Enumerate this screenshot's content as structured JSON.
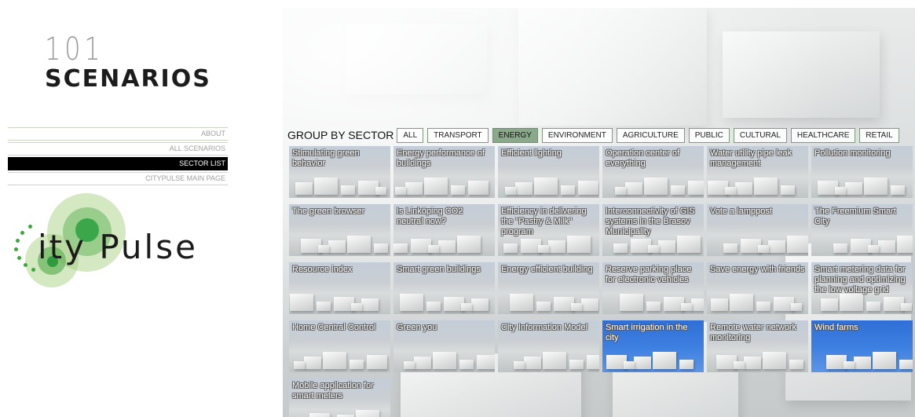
{
  "logo": {
    "number": "101",
    "word": "SCENARIOS"
  },
  "menu": [
    {
      "label": "ABOUT",
      "active": false
    },
    {
      "label": "ALL SCENARIOS",
      "active": false
    },
    {
      "label": "SECTOR LIST",
      "active": true
    },
    {
      "label": "CITYPULSE MAIN PAGE",
      "active": false
    }
  ],
  "citypulse_logo": {
    "text": "ity Pulse"
  },
  "sector_bar": {
    "label": "GROUP BY SECTOR",
    "buttons": [
      {
        "label": "ALL",
        "active": false
      },
      {
        "label": "TRANSPORT",
        "active": false
      },
      {
        "label": "ENERGY",
        "active": true
      },
      {
        "label": "ENVIRONMENT",
        "active": false
      },
      {
        "label": "AGRICULTURE",
        "active": false
      },
      {
        "label": "PUBLIC",
        "active": false
      },
      {
        "label": "CULTURAL",
        "active": false
      },
      {
        "label": "HEALTHCARE",
        "active": false
      },
      {
        "label": "RETAIL",
        "active": false
      }
    ]
  },
  "scenarios": [
    {
      "title": "Stimulating green behavior",
      "tint": "grey"
    },
    {
      "title": "Energy performance of buildings",
      "tint": "grey"
    },
    {
      "title": "Efficient lighting",
      "tint": "grey"
    },
    {
      "title": "Operation center of everything",
      "tint": "grey"
    },
    {
      "title": "Water utility pipe leak management",
      "tint": "grey"
    },
    {
      "title": "Pollution monitoring",
      "tint": "grey"
    },
    {
      "title": "The green browser",
      "tint": "grey"
    },
    {
      "title": "Is Linköping CO2 neutral now?",
      "tint": "grey"
    },
    {
      "title": "Efficiency in delivering the \"Pastry & Milk\" program",
      "tint": "grey"
    },
    {
      "title": "Interconnectivity of GIS systems in the Brasov Municipality",
      "tint": "grey"
    },
    {
      "title": "Vote a lamppost",
      "tint": "grey"
    },
    {
      "title": "The Freemium Smart City",
      "tint": "grey"
    },
    {
      "title": "Resource index",
      "tint": "grey"
    },
    {
      "title": "Smart green buildings",
      "tint": "grey"
    },
    {
      "title": "Energy efficient building",
      "tint": "grey"
    },
    {
      "title": "Reserve parking place for electronic vehicles",
      "tint": "grey"
    },
    {
      "title": "Save energy with friends",
      "tint": "grey"
    },
    {
      "title": "Smart metering data for planning and optimizing the low voltage grid",
      "tint": "grey"
    },
    {
      "title": "Home Central Control",
      "tint": "grey"
    },
    {
      "title": "Green you",
      "tint": "grey"
    },
    {
      "title": "City Information Model",
      "tint": "grey"
    },
    {
      "title": "Smart irrigation in the city",
      "tint": "blue"
    },
    {
      "title": "Remote water network monitoring",
      "tint": "grey"
    },
    {
      "title": "Wind farms",
      "tint": "blue"
    },
    {
      "title": "Mobile application for smart meters",
      "tint": "grey"
    }
  ],
  "colors": {
    "active_menu": "#000000",
    "active_sector": "#8aa88a",
    "logo_green": "#3da63d"
  }
}
